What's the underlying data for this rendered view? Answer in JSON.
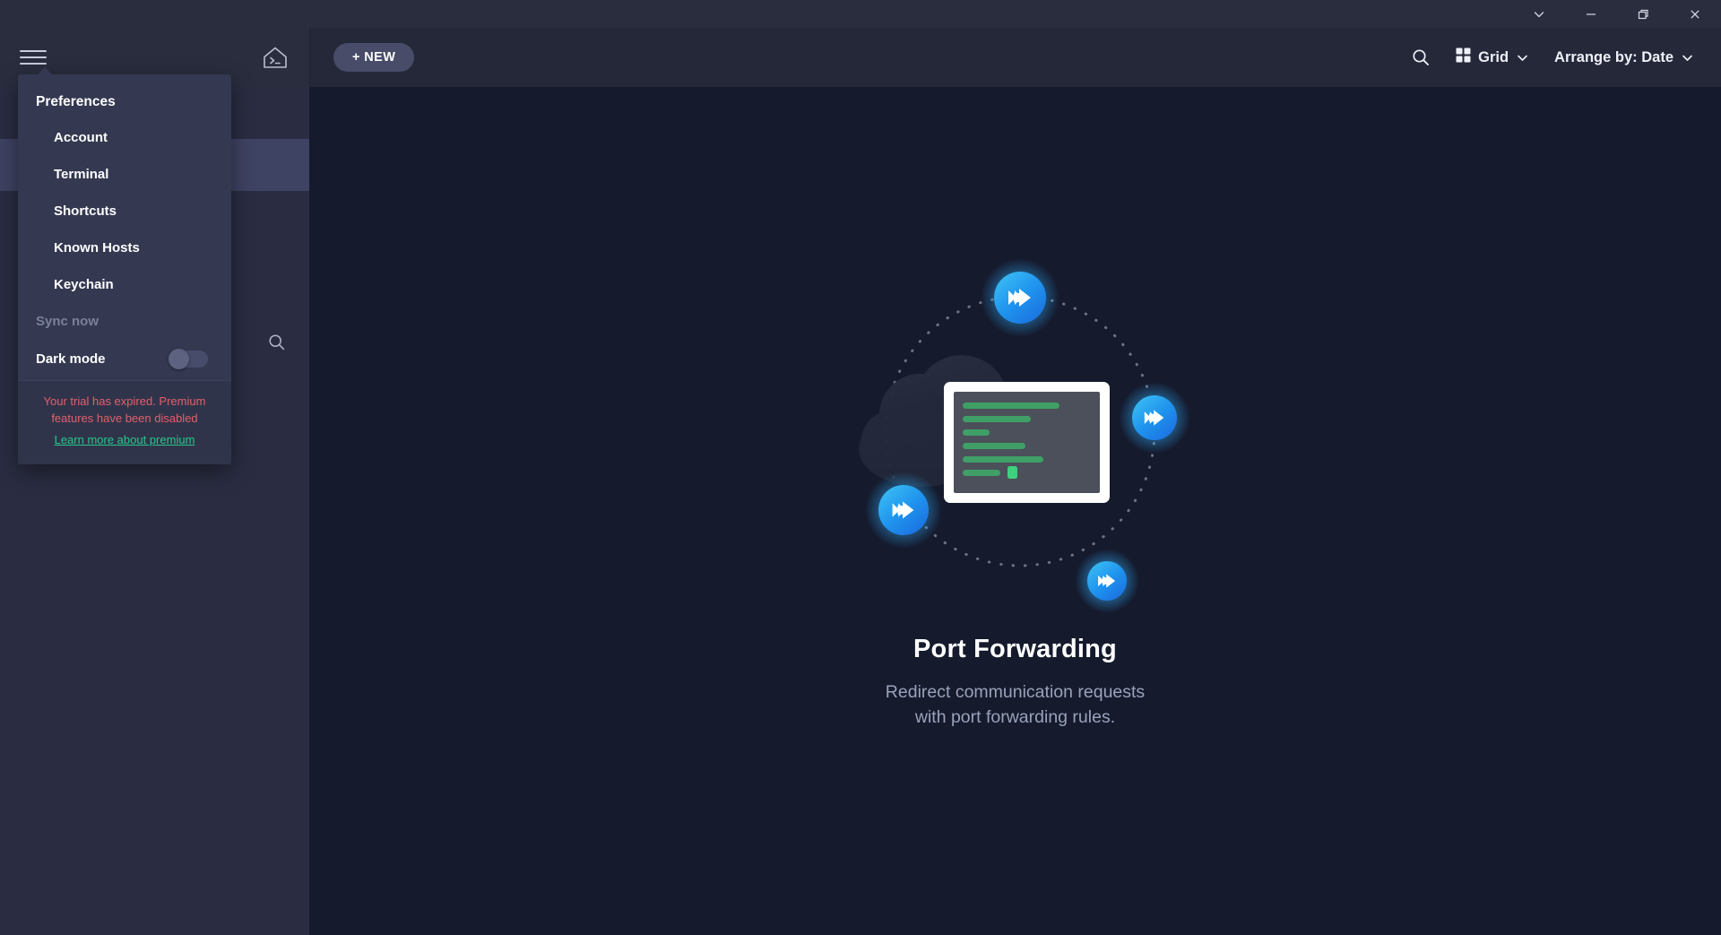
{
  "window": {
    "controls": [
      {
        "name": "expand-chevron",
        "label": "chevron-down-icon"
      },
      {
        "name": "minimize",
        "label": "minimize-icon"
      },
      {
        "name": "maximize",
        "label": "maximize-icon"
      },
      {
        "name": "close",
        "label": "close-icon"
      }
    ]
  },
  "toolbar": {
    "menu_icon": "hamburger-icon",
    "home_icon": "home-terminal-icon",
    "new_button": "+ NEW",
    "search_icon": "search-icon",
    "view_mode": {
      "label": "Grid",
      "icon": "grid-icon",
      "chevron": "chevron-down-icon"
    },
    "arrange": {
      "label": "Arrange by: Date",
      "chevron": "chevron-down-icon"
    }
  },
  "sidebar": {
    "search_icon": "search-icon",
    "rows": [
      {
        "state": "normal"
      },
      {
        "state": "active"
      },
      {
        "state": "normal"
      }
    ]
  },
  "menu": {
    "title": "Preferences",
    "items": [
      {
        "label": "Account",
        "state": "enabled"
      },
      {
        "label": "Terminal",
        "state": "enabled"
      },
      {
        "label": "Shortcuts",
        "state": "enabled"
      },
      {
        "label": "Known Hosts",
        "state": "enabled"
      },
      {
        "label": "Keychain",
        "state": "enabled"
      }
    ],
    "sync": {
      "label": "Sync now",
      "state": "disabled"
    },
    "dark_mode": {
      "label": "Dark mode",
      "enabled": false
    },
    "trial": {
      "message_line1": "Your trial has expired. Premium",
      "message_line2": "features have been disabled",
      "link": "Learn more about premium",
      "message_color": "#e2606a",
      "link_color": "#27c88a"
    }
  },
  "main": {
    "title": "Port Forwarding",
    "subtitle_line1": "Redirect communication requests",
    "subtitle_line2": "with port forwarding rules.",
    "illustration": {
      "name": "port-forwarding-illustration",
      "node_icon": "fast-forward-icon",
      "node_count": 4,
      "cloud_icon": "cloud-shape",
      "terminal_icon": "terminal-window",
      "accent_blue_light": "#3fc4f5",
      "accent_blue_dark": "#1b6fe0",
      "code_green": "#3f9f66",
      "cursor_green": "#3fd07e"
    }
  },
  "colors": {
    "titlebar_bg": "#2a2d3e",
    "toolbar_bg": "#252839",
    "sidebar_bg": "#2a2d42",
    "sidebar_active": "#3f4363",
    "content_bg": "#151a2d",
    "menu_bg": "#343850",
    "trial_bg": "#30344b",
    "new_button_bg": "#484c68"
  }
}
